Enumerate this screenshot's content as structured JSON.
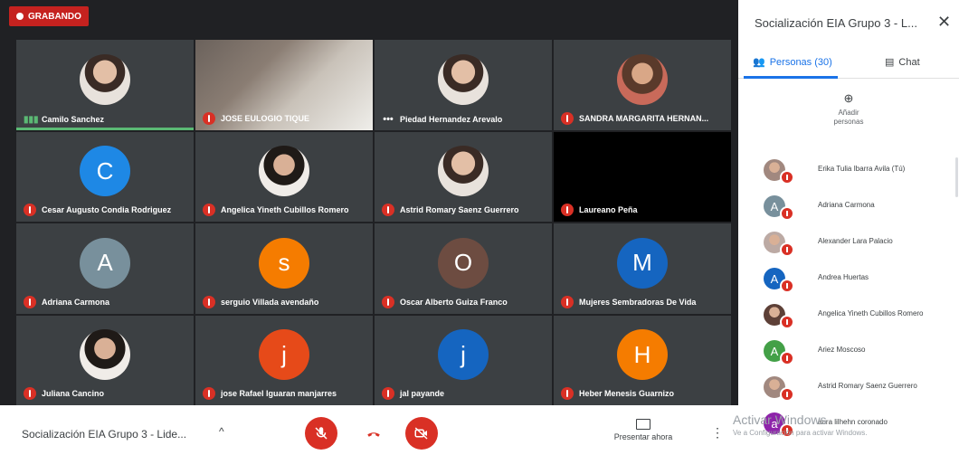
{
  "recording": {
    "label": "GRABANDO"
  },
  "tiles": [
    {
      "name": "Camilo Sanchez",
      "kind": "avatar",
      "style": "photo",
      "status": "speaking",
      "active": true
    },
    {
      "name": "JOSE EULOGIO TIQUE",
      "kind": "video",
      "status": "muted"
    },
    {
      "name": "Piedad Hernandez Arevalo",
      "kind": "avatar",
      "style": "photo",
      "status": "dots"
    },
    {
      "name": "SANDRA MARGARITA HERNAN...",
      "kind": "avatar",
      "style": "photo3",
      "status": "muted"
    },
    {
      "name": "Cesar Augusto Condia Rodriguez",
      "kind": "avatar",
      "letter": "C",
      "color": "#1e88e5",
      "status": "muted"
    },
    {
      "name": "Angelica Yineth Cubillos Romero",
      "kind": "avatar",
      "style": "photo2",
      "status": "muted"
    },
    {
      "name": "Astrid Romary Saenz Guerrero",
      "kind": "avatar",
      "style": "photo",
      "status": "muted"
    },
    {
      "name": "Laureano Peña",
      "kind": "dark",
      "status": "muted"
    },
    {
      "name": "Adriana Carmona",
      "kind": "avatar",
      "letter": "A",
      "color": "#78909c",
      "status": "muted"
    },
    {
      "name": "serguio Villada avendaño",
      "kind": "avatar",
      "letter": "s",
      "color": "#f57c00",
      "status": "muted"
    },
    {
      "name": "Oscar Alberto Guiza Franco",
      "kind": "avatar",
      "letter": "O",
      "color": "#6d4c41",
      "status": "muted"
    },
    {
      "name": "Mujeres Sembradoras De Vida",
      "kind": "avatar",
      "letter": "M",
      "color": "#1565c0",
      "status": "muted"
    },
    {
      "name": "Juliana Cancino",
      "kind": "avatar",
      "style": "photo2",
      "status": "muted"
    },
    {
      "name": "jose Rafael Iguaran manjarres",
      "kind": "avatar",
      "letter": "j",
      "color": "#e64a19",
      "status": "muted"
    },
    {
      "name": "jal payande",
      "kind": "avatar",
      "letter": "j",
      "color": "#1565c0",
      "status": "muted"
    },
    {
      "name": "Heber Menesis Guarnizo",
      "kind": "avatar",
      "letter": "H",
      "color": "#f57c00",
      "status": "muted"
    }
  ],
  "bottom": {
    "meeting_name": "Socialización EIA Grupo 3 - Lide...",
    "present_label": "Presentar ahora"
  },
  "panel": {
    "title": "Socialización EIA Grupo 3 - L...",
    "people_tab": "Personas (30)",
    "chat_tab": "Chat",
    "add_label_1": "Añadir",
    "add_label_2": "personas",
    "people": [
      {
        "name": "Erika Tulia Ibarra Avila (Tú)",
        "style": "photo",
        "color": "#a1887f"
      },
      {
        "name": "Adriana Carmona",
        "letter": "A",
        "color": "#78909c"
      },
      {
        "name": "Alexander Lara Palacio",
        "style": "photo2",
        "color": "#bcaaa4"
      },
      {
        "name": "Andrea Huertas",
        "letter": "A",
        "color": "#1565c0"
      },
      {
        "name": "Angelica Yineth Cubillos Romero",
        "style": "photo2",
        "color": "#5d4037"
      },
      {
        "name": "Ariez Moscoso",
        "letter": "A",
        "color": "#43a047"
      },
      {
        "name": "Astrid Romary Saenz Guerrero",
        "style": "photo",
        "color": "#a1887f"
      },
      {
        "name": "aura lilhehn coronado",
        "letter": "a",
        "color": "#8e24aa"
      }
    ]
  },
  "watermark": {
    "title": "Activar Windows",
    "subtitle": "Ve a Configuración para activar Windows."
  }
}
